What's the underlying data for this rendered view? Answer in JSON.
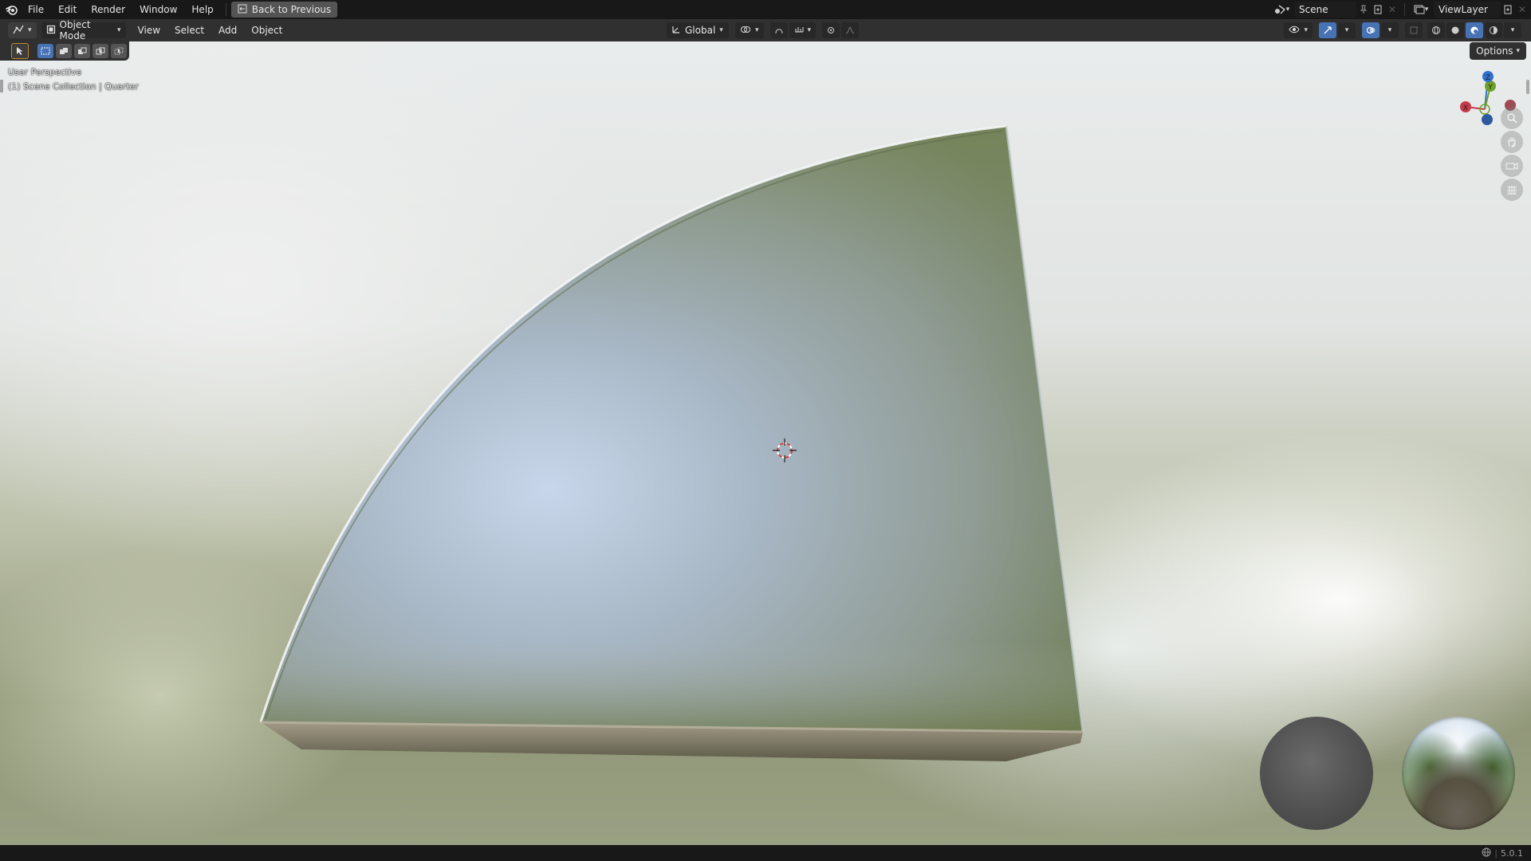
{
  "topbar": {
    "menu": [
      "File",
      "Edit",
      "Render",
      "Window",
      "Help"
    ],
    "back_button": "Back to Previous",
    "scene": "Scene",
    "view_layer": "ViewLayer"
  },
  "header": {
    "mode": "Object Mode",
    "menus": [
      "View",
      "Select",
      "Add",
      "Object"
    ],
    "orientation": "Global"
  },
  "toolbar": {
    "options_label": "Options"
  },
  "viewport": {
    "view_name": "User Perspective",
    "collection_info": "(1) Scene Collection | Quarter",
    "axis_x": "X",
    "axis_y": "Y",
    "axis_z": "Z"
  },
  "statusbar": {
    "version": "5.0.1"
  },
  "colors": {
    "accent": "#4772b3",
    "axis_x": "#c8394a",
    "axis_y": "#6fa12a",
    "axis_z": "#2f6fcf"
  }
}
